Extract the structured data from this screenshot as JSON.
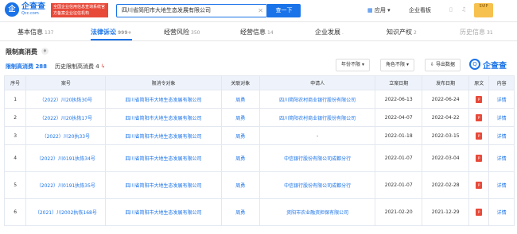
{
  "header": {
    "logo_name": "企查查",
    "logo_sub": "Qcc.com",
    "badge_text": "全国企业信用信息查询系统官方备案企业征信机构",
    "search_value": "四川省简阳市大地生态发展有限公司",
    "search_button": "查一下",
    "nav_app": "应用",
    "nav_kanban": "企业看板",
    "vip_label": "SVIP"
  },
  "tabs": [
    {
      "label": "基本信息",
      "count": "137"
    },
    {
      "label": "法律诉讼",
      "count": "999+"
    },
    {
      "label": "经营风险",
      "count": "350"
    },
    {
      "label": "经营信息",
      "count": "14"
    },
    {
      "label": "企业发展",
      "count": "."
    },
    {
      "label": "知识产权",
      "count": "2"
    },
    {
      "label": "历史信息",
      "count": "31"
    }
  ],
  "section": {
    "title": "限制高消费",
    "subtab_current": "限制高消费",
    "subtab_current_count": "288",
    "subtab_history": "历史限制高消费",
    "subtab_history_count": "4",
    "filter_year": "年份不限",
    "filter_role": "角色不限",
    "export": "导出数据",
    "watermark": "企查查"
  },
  "table": {
    "headers": [
      "序号",
      "案号",
      "限消令对象",
      "关联对象",
      "申请人",
      "立案日期",
      "发布日期",
      "原文",
      "内容"
    ],
    "rows": [
      {
        "no": "1",
        "case": "（2022）川20执恢30号",
        "target": "四川省简阳市大地生态发展有限公司",
        "related": "周勇",
        "applicant": "四川简阳农村商业银行股份有限公司",
        "filed": "2022-06-13",
        "published": "2022-06-24",
        "detail": "详情"
      },
      {
        "no": "2",
        "case": "（2022）川20执恢17号",
        "target": "四川省简阳市大地生态发展有限公司",
        "related": "周勇",
        "applicant": "四川简阳农村商业银行股份有限公司",
        "filed": "2022-04-07",
        "published": "2022-04-22",
        "detail": "详情"
      },
      {
        "no": "3",
        "case": "（2022）川20执33号",
        "target": "四川省简阳市大地生态发展有限公司",
        "related": "周勇",
        "applicant": "-",
        "filed": "2022-01-18",
        "published": "2022-03-15",
        "detail": "详情"
      },
      {
        "no": "4",
        "case": "（2022）川0191执恢34号",
        "target": "四川省简阳市大地生态发展有限公司",
        "related": "周勇",
        "applicant": "中信银行股份有限公司成都分行",
        "filed": "2022-01-07",
        "published": "2022-03-04",
        "detail": "详情"
      },
      {
        "no": "5",
        "case": "（2022）川0191执恢35号",
        "target": "四川省简阳市大地生态发展有限公司",
        "related": "周勇",
        "applicant": "中信银行股份有限公司成都分行",
        "filed": "2022-01-07",
        "published": "2022-02-28",
        "detail": "详情"
      },
      {
        "no": "6",
        "case": "（2021）川2002执恢168号",
        "target": "四川省简阳市大地生态发展有限公司",
        "related": "周勇",
        "applicant": "资阳市农业融资担保有限公司",
        "filed": "2021-02-20",
        "published": "2021-12-29",
        "detail": "详情"
      }
    ]
  },
  "colors": {
    "accent": "#1a73e8",
    "brand_red": "#e84a3a",
    "header_bg": "#eef3fb"
  }
}
